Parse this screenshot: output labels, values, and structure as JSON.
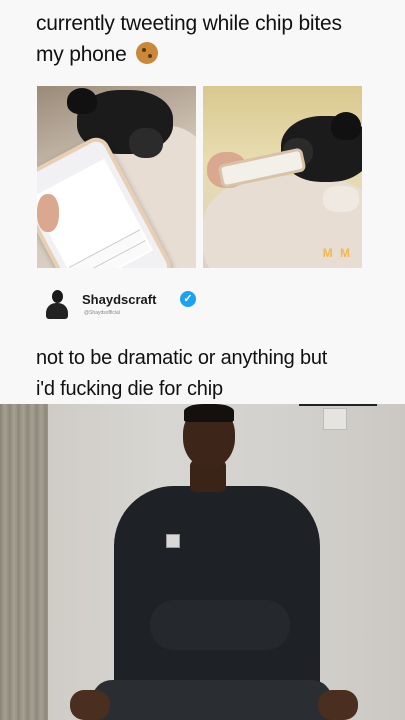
{
  "meme": {
    "caption_line1": "currently tweeting while chip bites",
    "caption_line2": "my phone",
    "caption_emoji": "cookie-emoji",
    "tweet": {
      "name": "Shaydscraft",
      "verified_mark": "✓",
      "handle": "@Shaydsofficial",
      "text_line1": "not to be dramatic or anything but",
      "text_line2": "i'd fucking die for chip"
    },
    "photo_watermark": "M M"
  },
  "colors": {
    "verified_blue": "#1da1f2",
    "sweater": "#1e2125"
  }
}
